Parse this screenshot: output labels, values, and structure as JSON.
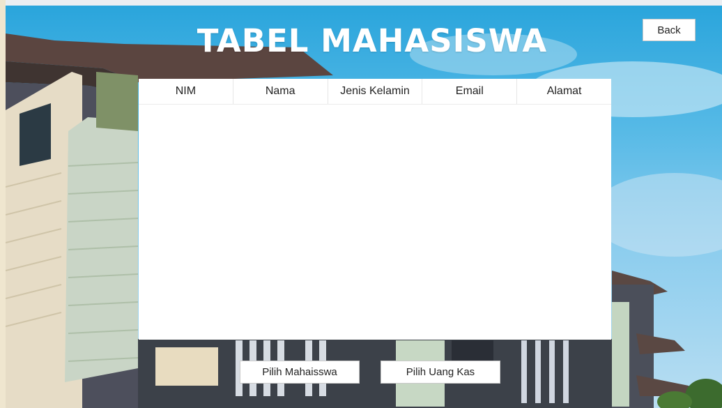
{
  "page": {
    "title": "TABEL MAHASISWA"
  },
  "buttons": {
    "back": "Back",
    "pilih_mahasiswa": "Pilih Mahaisswa",
    "pilih_uang_kas": "Pilih Uang Kas"
  },
  "table": {
    "columns": [
      "NIM",
      "Nama",
      "Jenis Kelamin",
      "Email",
      "Alamat"
    ],
    "rows": []
  },
  "icons": {
    "background": "building-photo-background"
  }
}
